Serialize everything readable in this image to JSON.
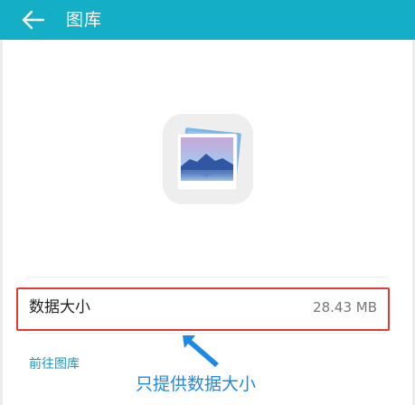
{
  "appbar": {
    "title": "图库",
    "back_icon": "arrow-left-icon",
    "background_color": "#14aec6"
  },
  "app": {
    "icon": "gallery-photo-icon"
  },
  "storage": {
    "label": "数据大小",
    "value": "28.43 MB"
  },
  "actions": {
    "goto_gallery": "前往图库"
  },
  "annotation": {
    "text": "只提供数据大小",
    "arrow_icon": "annotation-arrow-icon",
    "highlight_color": "#e53935",
    "text_color": "#1e88e5"
  }
}
